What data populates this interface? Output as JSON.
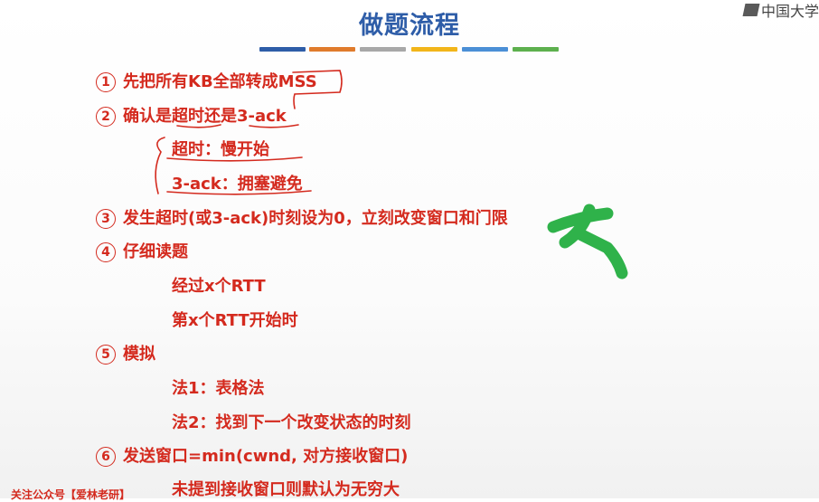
{
  "title": "做题流程",
  "watermark": "中国大学",
  "color_bars": [
    "#2e5da8",
    "#e07b2c",
    "#a8a8a8",
    "#f2b51a",
    "#4b8fd6",
    "#5db04e"
  ],
  "steps": [
    {
      "num": "1",
      "text": "先把所有KB全部转成MSS"
    },
    {
      "num": "2",
      "text": "确认是超时还是3-ack"
    },
    {
      "num": "3",
      "text": "发生超时(或3-ack)时刻设为0，立刻改变窗口和门限"
    },
    {
      "num": "4",
      "text": "仔细读题"
    },
    {
      "num": "5",
      "text": "模拟"
    },
    {
      "num": "6",
      "text": "发送窗口=min(cwnd, 对方接收窗口)"
    }
  ],
  "sub_items": {
    "timeout": "超时：慢开始",
    "three_ack": "3-ack：拥塞避免",
    "rtt_passed": "经过x个RTT",
    "rtt_start": "第x个RTT开始时",
    "method1": "法1：表格法",
    "method2": "法2：找到下一个改变状态的时刻",
    "no_recv_window": "未提到接收窗口则默认为无穷大"
  },
  "footer": "关注公众号【爱林老研】"
}
